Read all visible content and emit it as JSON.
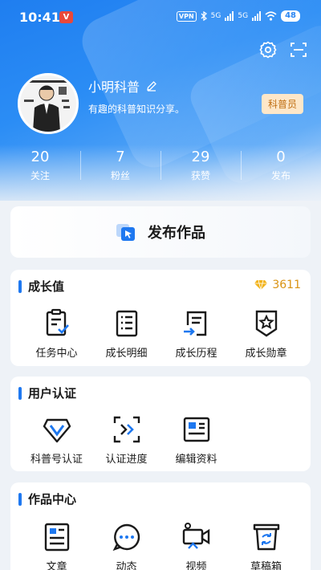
{
  "status_bar": {
    "time": "10:41",
    "app_badge": "V",
    "vpn": "VPN",
    "net1": "5G",
    "net2": "5G",
    "battery": "48"
  },
  "profile": {
    "username": "小明科普",
    "bio": "有趣的科普知识分享。",
    "badge": "科普员",
    "stats": [
      {
        "value": "20",
        "label": "关注"
      },
      {
        "value": "7",
        "label": "粉丝"
      },
      {
        "value": "29",
        "label": "获赞"
      },
      {
        "value": "0",
        "label": "发布"
      }
    ]
  },
  "publish": {
    "label": "发布作品"
  },
  "growth": {
    "title": "成长值",
    "points": "3611",
    "items": [
      {
        "label": "任务中心",
        "icon": "task-icon"
      },
      {
        "label": "成长明细",
        "icon": "list-icon"
      },
      {
        "label": "成长历程",
        "icon": "history-icon"
      },
      {
        "label": "成长勋章",
        "icon": "medal-icon"
      }
    ]
  },
  "certification": {
    "title": "用户认证",
    "items": [
      {
        "label": "科普号认证",
        "icon": "verify-icon"
      },
      {
        "label": "认证进度",
        "icon": "progress-icon"
      },
      {
        "label": "编辑资料",
        "icon": "edit-profile-icon"
      }
    ]
  },
  "works": {
    "title": "作品中心",
    "items": [
      {
        "label": "文章",
        "icon": "article-icon"
      },
      {
        "label": "动态",
        "icon": "moment-icon"
      },
      {
        "label": "视频",
        "icon": "video-icon"
      },
      {
        "label": "草稿箱",
        "icon": "drafts-icon"
      }
    ]
  },
  "colors": {
    "accent": "#1e78f0",
    "gold": "#d99313",
    "badge_bg": "#fde7c9"
  }
}
